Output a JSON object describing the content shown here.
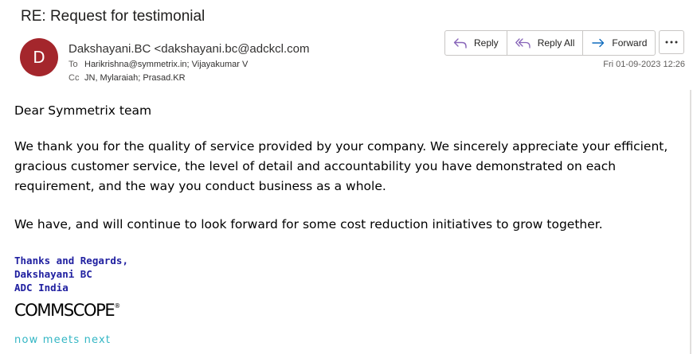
{
  "email": {
    "subject": "RE: Request for testimonial",
    "avatar_initial": "D",
    "avatar_color": "#a4262c",
    "from": "Dakshayani.BC <dakshayani.bc@adckcl.com",
    "to_label": "To",
    "to": "Harikrishna@symmetrix.in; Vijayakumar V",
    "cc_label": "Cc",
    "cc": "JN, Mylaraiah; Prasad.KR",
    "date": "Fri 01-09-2023 12:26"
  },
  "actions": {
    "reply": "Reply",
    "reply_all": "Reply All",
    "forward": "Forward",
    "reply_icon": "reply-icon",
    "reply_all_icon": "reply-all-icon",
    "forward_icon": "forward-icon",
    "more_icon": "more-options-icon"
  },
  "body": {
    "greeting": "Dear Symmetrix team",
    "paragraph1": "We thank you for the quality of service provided by your company. We sincerely appreciate your efficient, gracious customer service, the level of detail and accountability you have demonstrated on each requirement, and the way you conduct business as a whole.",
    "paragraph2": "We have, and will continue to look forward for some cost reduction initiatives to grow together."
  },
  "signature": {
    "line1": "Thanks and Regards,",
    "line2": "Dakshayani BC",
    "line3": "ADC India",
    "logo_text": "COMMSCOPE",
    "logo_mark": "®",
    "tagline": "now meets next",
    "text_color": "#1f1fa0",
    "tagline_color": "#33b6c4"
  }
}
